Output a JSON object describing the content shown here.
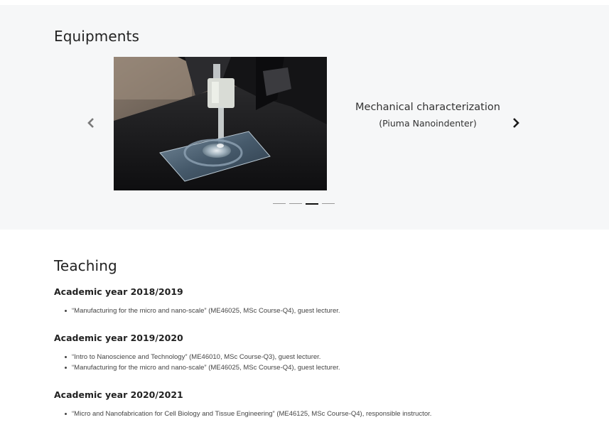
{
  "equipments": {
    "title": "Equipments",
    "slide": {
      "caption_title": "Mechanical characterization",
      "caption_subtitle": "(Piuma Nanoindenter)",
      "image_icon": "nanoindenter-photo"
    },
    "prev_icon": "chevron-left-icon",
    "next_icon": "chevron-right-icon",
    "indicators": 4,
    "active_indicator": 3
  },
  "teaching": {
    "title": "Teaching",
    "years": [
      {
        "heading": "Academic year 2018/2019",
        "courses": [
          "“Manufacturing for the micro and nano-scale” (ME46025, MSc Course-Q4), guest lecturer."
        ]
      },
      {
        "heading": "Academic year 2019/2020",
        "courses": [
          "“Intro to Nanoscience and Technology” (ME46010, MSc Course-Q3), guest lecturer.",
          "“Manufacturing for the micro and nano-scale” (ME46025, MSc Course-Q4), guest lecturer."
        ]
      },
      {
        "heading": "Academic year 2020/2021",
        "courses": [
          "“Micro and Nanofabrication for Cell Biology and Tissue Engineering” (ME46125, MSc Course-Q4), responsible instructor."
        ]
      }
    ]
  }
}
